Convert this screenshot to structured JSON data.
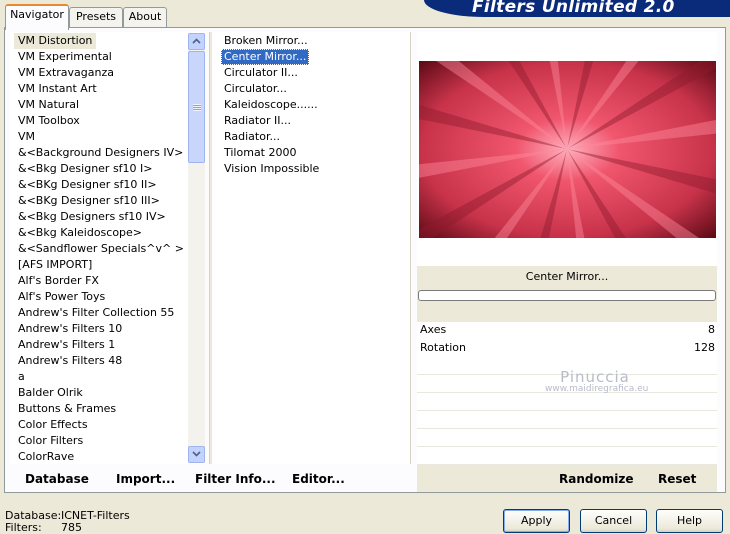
{
  "tabs": [
    {
      "label": "Navigator",
      "active": true
    },
    {
      "label": "Presets",
      "active": false
    },
    {
      "label": "About",
      "active": false
    }
  ],
  "banner_title": "Filters Unlimited 2.0",
  "categories": [
    "VM Distortion",
    "VM Experimental",
    "VM Extravaganza",
    "VM Instant Art",
    "VM Natural",
    "VM Toolbox",
    "VM",
    "&<Background Designers IV>",
    "&<Bkg Designer sf10 I>",
    "&<BKg Designer sf10 II>",
    "&<BKg Designer sf10 III>",
    "&<Bkg Designers sf10 IV>",
    "&<Bkg Kaleidoscope>",
    "&<Sandflower Specials^v^ >",
    "[AFS IMPORT]",
    "Alf's Border FX",
    "Alf's Power Toys",
    "Andrew's Filter Collection 55",
    "Andrew's Filters 10",
    "Andrew's Filters 1",
    "Andrew's Filters 48",
    "a",
    "Balder Olrik",
    "Buttons & Frames",
    "Color Effects",
    "Color Filters",
    "ColorRave"
  ],
  "selected_category": "VM Distortion",
  "filters": [
    "Broken Mirror...",
    "Center Mirror...",
    "Circulator II...",
    "Circulator...",
    "Kaleidoscope......",
    "Radiator II...",
    "Radiator...",
    "Tilomat 2000",
    "Vision Impossible"
  ],
  "selected_filter": "Center Mirror...",
  "preview_filter_name": "Center Mirror...",
  "params": [
    {
      "name": "Axes",
      "value": "8"
    },
    {
      "name": "Rotation",
      "value": "128"
    }
  ],
  "watermark": {
    "line1": "Pinuccia",
    "line2": "www.maidiregrafica.eu"
  },
  "toolbar": {
    "database": "Database",
    "import": "Import...",
    "filter_info": "Filter Info...",
    "editor": "Editor...",
    "randomize": "Randomize",
    "reset": "Reset"
  },
  "footer": {
    "database_label": "Database:",
    "database_value": "ICNET-Filters",
    "filters_label": "Filters:",
    "filters_value": "785"
  },
  "buttons": {
    "apply": "Apply",
    "cancel": "Cancel",
    "help": "Help"
  },
  "colors": {
    "preview_light": "#f0566e",
    "preview_mid": "#c8334a",
    "preview_dark": "#5e0a16",
    "selection": "#316ac5",
    "banner": "#0a2a7a"
  }
}
